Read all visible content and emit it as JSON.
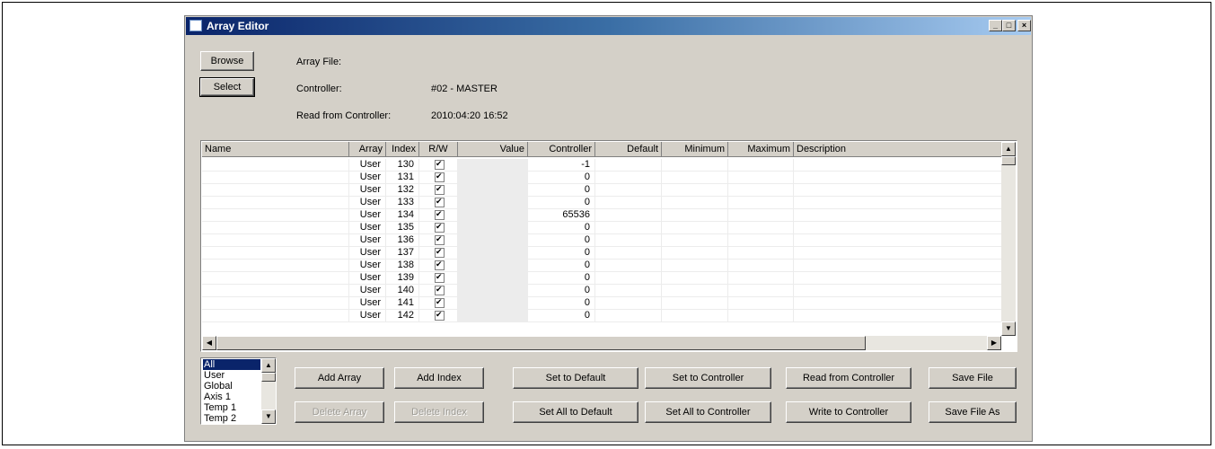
{
  "window": {
    "title": "Array Editor",
    "minimize": "_",
    "maximize": "□",
    "close": "×"
  },
  "top": {
    "browse_label": "Browse",
    "select_label": "Select",
    "array_file_label": "Array File:",
    "array_file_value": "",
    "controller_label": "Controller:",
    "controller_value": "#02 - MASTER",
    "read_label": "Read from Controller:",
    "read_value": "2010:04:20 16:52"
  },
  "table": {
    "headers": [
      "Name",
      "Array",
      "Index",
      "R/W",
      "Value",
      "Controller",
      "Default",
      "Minimum",
      "Maximum",
      "Description"
    ],
    "rows": [
      {
        "name": "",
        "array": "User",
        "index": "130",
        "rw": true,
        "value": "",
        "controller": "-1",
        "default": "",
        "minimum": "",
        "maximum": "",
        "description": ""
      },
      {
        "name": "",
        "array": "User",
        "index": "131",
        "rw": true,
        "value": "",
        "controller": "0",
        "default": "",
        "minimum": "",
        "maximum": "",
        "description": ""
      },
      {
        "name": "",
        "array": "User",
        "index": "132",
        "rw": true,
        "value": "",
        "controller": "0",
        "default": "",
        "minimum": "",
        "maximum": "",
        "description": ""
      },
      {
        "name": "",
        "array": "User",
        "index": "133",
        "rw": true,
        "value": "",
        "controller": "0",
        "default": "",
        "minimum": "",
        "maximum": "",
        "description": ""
      },
      {
        "name": "",
        "array": "User",
        "index": "134",
        "rw": true,
        "value": "",
        "controller": "65536",
        "default": "",
        "minimum": "",
        "maximum": "",
        "description": ""
      },
      {
        "name": "",
        "array": "User",
        "index": "135",
        "rw": true,
        "value": "",
        "controller": "0",
        "default": "",
        "minimum": "",
        "maximum": "",
        "description": ""
      },
      {
        "name": "",
        "array": "User",
        "index": "136",
        "rw": true,
        "value": "",
        "controller": "0",
        "default": "",
        "minimum": "",
        "maximum": "",
        "description": ""
      },
      {
        "name": "",
        "array": "User",
        "index": "137",
        "rw": true,
        "value": "",
        "controller": "0",
        "default": "",
        "minimum": "",
        "maximum": "",
        "description": ""
      },
      {
        "name": "",
        "array": "User",
        "index": "138",
        "rw": true,
        "value": "",
        "controller": "0",
        "default": "",
        "minimum": "",
        "maximum": "",
        "description": ""
      },
      {
        "name": "",
        "array": "User",
        "index": "139",
        "rw": true,
        "value": "",
        "controller": "0",
        "default": "",
        "minimum": "",
        "maximum": "",
        "description": ""
      },
      {
        "name": "",
        "array": "User",
        "index": "140",
        "rw": true,
        "value": "",
        "controller": "0",
        "default": "",
        "minimum": "",
        "maximum": "",
        "description": ""
      },
      {
        "name": "",
        "array": "User",
        "index": "141",
        "rw": true,
        "value": "",
        "controller": "0",
        "default": "",
        "minimum": "",
        "maximum": "",
        "description": ""
      },
      {
        "name": "",
        "array": "User",
        "index": "142",
        "rw": true,
        "value": "",
        "controller": "0",
        "default": "",
        "minimum": "",
        "maximum": "",
        "description": ""
      }
    ]
  },
  "array_list": {
    "items": [
      "All",
      "User",
      "Global",
      "Axis 1",
      "Temp 1",
      "Temp 2"
    ],
    "selected": "All"
  },
  "buttons": {
    "add_array": "Add Array",
    "delete_array": "Delete Array",
    "add_index": "Add Index",
    "delete_index": "Delete Index",
    "set_default": "Set to Default",
    "set_all_default": "Set All to Default",
    "set_controller": "Set to Controller",
    "set_all_controller": "Set All to Controller",
    "read_controller": "Read from Controller",
    "write_controller": "Write to Controller",
    "save_file": "Save File",
    "save_file_as": "Save File As"
  }
}
